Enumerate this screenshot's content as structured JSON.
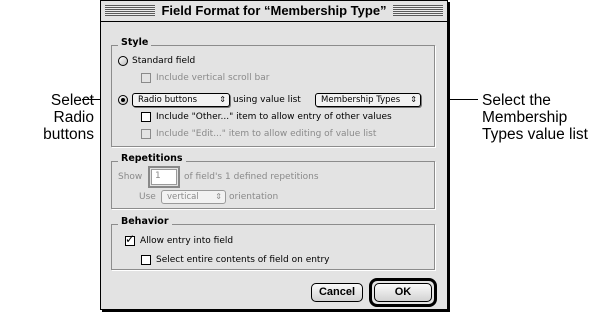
{
  "callouts": {
    "left": {
      "line1": "Select",
      "line2": "Radio",
      "line3": "buttons"
    },
    "right": {
      "line1": "Select the",
      "line2": "Membership",
      "line3": "Types value list"
    }
  },
  "dialog": {
    "title": "Field Format for “Membership Type”",
    "style": {
      "label": "Style",
      "standard_field": "Standard field",
      "vertical_scroll": "Include vertical scroll bar",
      "display_type_value": "Radio buttons",
      "using_value_list": "using value list",
      "value_list_selected": "Membership Types",
      "include_other": "Include \"Other...\" item to allow entry of other values",
      "include_edit": "Include \"Edit...\" item to allow editing of value list"
    },
    "repetitions": {
      "label": "Repetitions",
      "show": "Show",
      "count_value": "1",
      "of_defined": "of field's 1 defined repetitions",
      "use": "Use",
      "orientation_value": "vertical",
      "orientation": "orientation"
    },
    "behavior": {
      "label": "Behavior",
      "allow_entry": "Allow entry into field",
      "select_entire": "Select entire contents of field on entry"
    },
    "buttons": {
      "cancel": "Cancel",
      "ok": "OK"
    }
  }
}
